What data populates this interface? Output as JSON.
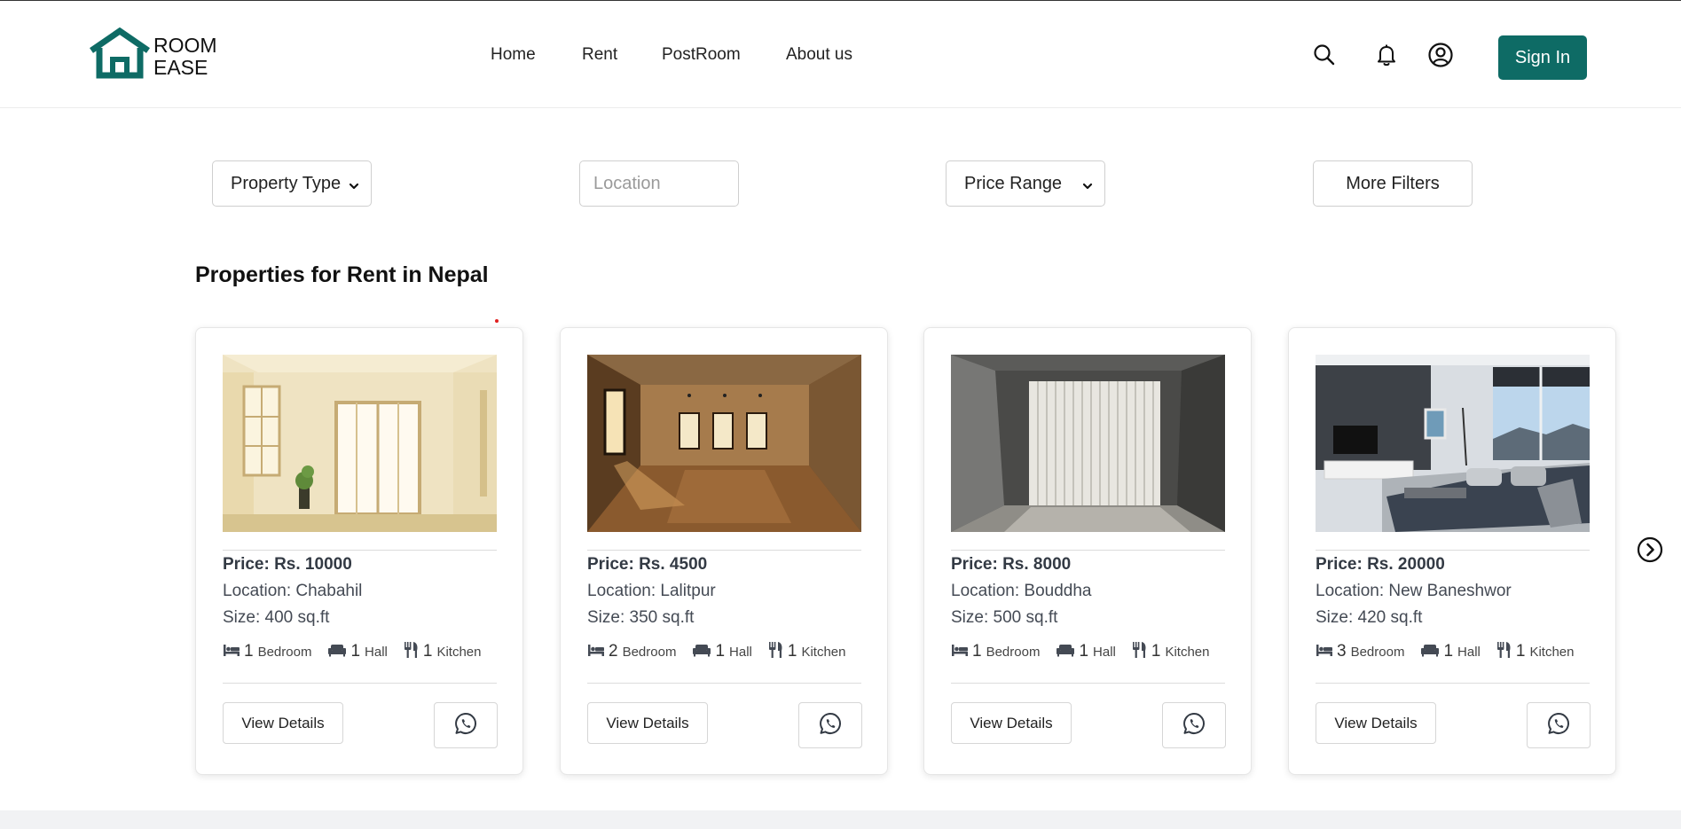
{
  "brand": {
    "name_line1": "ROOM",
    "name_line2": "EASE",
    "color": "#0e6b65"
  },
  "nav": {
    "items": [
      {
        "label": "Home"
      },
      {
        "label": "Rent"
      },
      {
        "label": "PostRoom"
      },
      {
        "label": "About us"
      }
    ]
  },
  "header": {
    "icons": [
      "search-icon",
      "bell-icon",
      "user-circle-icon"
    ],
    "signin_label": "Sign In"
  },
  "filters": {
    "property_type": "Property Type",
    "location_placeholder": "Location",
    "price_range": "Price Range",
    "more_filters": "More Filters"
  },
  "section": {
    "title": "Properties for Rent in Nepal"
  },
  "listings": [
    {
      "price": "Price: Rs. 10000",
      "location": "Location: Chabahil",
      "size": "Size: 400 sq.ft",
      "bedroom_count": "1",
      "bedroom_label": "Bedroom",
      "hall_count": "1",
      "hall_label": "Hall",
      "kitchen_count": "1",
      "kitchen_label": "Kitchen",
      "view_label": "View Details"
    },
    {
      "price": "Price: Rs. 4500",
      "location": "Location: Lalitpur",
      "size": "Size: 350 sq.ft",
      "bedroom_count": "2",
      "bedroom_label": "Bedroom",
      "hall_count": "1",
      "hall_label": "Hall",
      "kitchen_count": "1",
      "kitchen_label": "Kitchen",
      "view_label": "View Details"
    },
    {
      "price": "Price: Rs. 8000",
      "location": "Location: Bouddha",
      "size": "Size: 500 sq.ft",
      "bedroom_count": "1",
      "bedroom_label": "Bedroom",
      "hall_count": "1",
      "hall_label": "Hall",
      "kitchen_count": "1",
      "kitchen_label": "Kitchen",
      "view_label": "View Details"
    },
    {
      "price": "Price: Rs. 20000",
      "location": "Location: New Baneshwor",
      "size": "Size: 420 sq.ft",
      "bedroom_count": "3",
      "bedroom_label": "Bedroom",
      "hall_count": "1",
      "hall_label": "Hall",
      "kitchen_count": "1",
      "kitchen_label": "Kitchen",
      "view_label": "View Details"
    }
  ],
  "colors": {
    "accent": "#0e6b65",
    "footer_band": "#f1f2f4"
  }
}
